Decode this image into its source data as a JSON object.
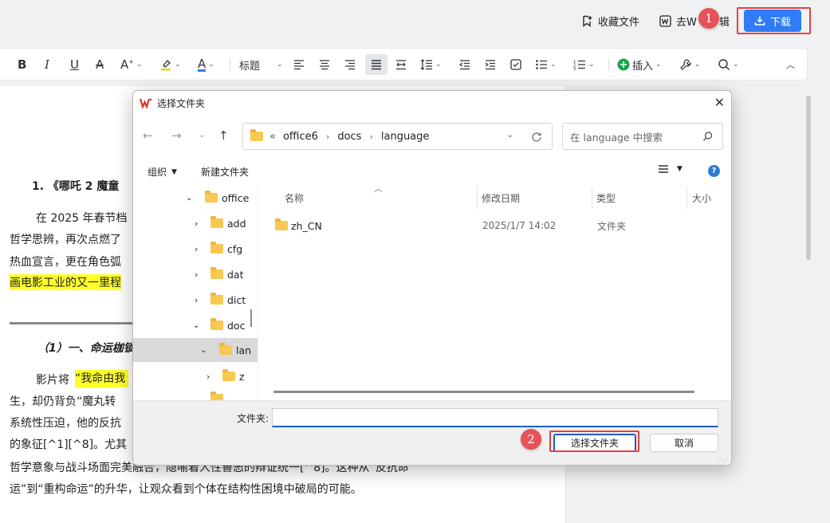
{
  "header": {
    "favorite_label": "收藏文件",
    "wps_edit_label_left": "去W",
    "wps_edit_label_right": "辑",
    "download_label": "下载"
  },
  "toolbar": {
    "heading_style": "标题",
    "insert_label": "插入"
  },
  "document": {
    "heading": "1. 《哪吒 2 魔童",
    "para1_line1": "在 2025 年春节档",
    "para1_line2": "哲学思辨，再次点燃了",
    "para1_line3": "热血宣言，更在角色弧",
    "para1_line4": "画电影工业的又一里程",
    "subheading": "（1）一、命运枷锁",
    "para2_line1a": "影片将",
    "para2_line1b": "“我命由我",
    "para2_line2": "生，却仍背负“魔丸转",
    "para2_line3": "系统性压迫，他的反抗",
    "para2_line4": "的象征[^1][^8]。尤其",
    "para2_line5": "哲学意象与战斗场面完美融合，隐喻着人性善恶的辩证统一[^8]。这种从“反抗命",
    "para2_line6": "运”到“重构命运”的升华，让观众看到个体在结构性困境中破局的可能。"
  },
  "dialog": {
    "title": "选择文件夹",
    "breadcrumb_prefix": "«",
    "breadcrumb": [
      "office6",
      "docs",
      "language"
    ],
    "search_placeholder": "在 language 中搜索",
    "organize_label": "组织",
    "new_folder_label": "新建文件夹",
    "tree": [
      {
        "label": "office",
        "expanded": true,
        "level": 0
      },
      {
        "label": "add",
        "expanded": false,
        "level": 1
      },
      {
        "label": "cfg",
        "expanded": false,
        "level": 1
      },
      {
        "label": "dat",
        "expanded": false,
        "level": 1
      },
      {
        "label": "dict",
        "expanded": false,
        "level": 1
      },
      {
        "label": "doc",
        "expanded": true,
        "level": 1
      },
      {
        "label": "lan",
        "expanded": true,
        "level": 2,
        "selected": true
      },
      {
        "label": "z",
        "expanded": false,
        "level": 3
      }
    ],
    "columns": {
      "name": "名称",
      "modified": "修改日期",
      "type": "类型",
      "size": "大小"
    },
    "files": [
      {
        "name": "zh_CN",
        "modified": "2025/1/7 14:02",
        "type": "文件夹"
      }
    ],
    "folder_field_label": "文件夹:",
    "folder_field_value": "",
    "select_button": "选择文件夹",
    "cancel_button": "取消"
  },
  "annotations": {
    "badge1": "1",
    "badge2": "2",
    "color": "#e5413e"
  },
  "colors": {
    "accent": "#2f7cf6",
    "highlight": "#ffff2a",
    "folder": "#f7c852"
  }
}
